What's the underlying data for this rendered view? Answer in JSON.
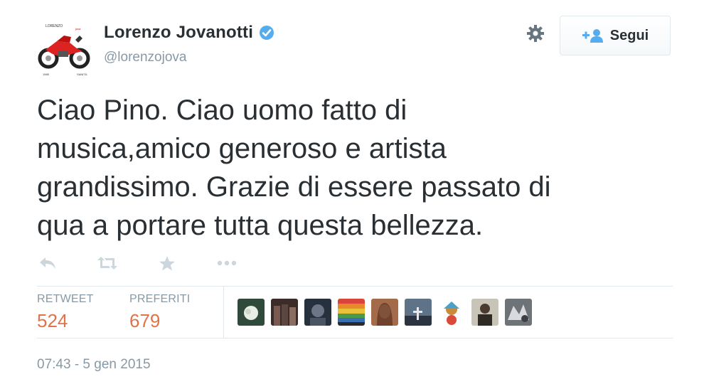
{
  "author": {
    "display_name": "Lorenzo Jovanotti",
    "handle": "@lorenzojova",
    "verified": true,
    "avatar_icon": "motorcycle-logo-icon"
  },
  "follow_button": {
    "label": "Segui",
    "icon": "add-user-icon"
  },
  "settings_icon": "gear-icon",
  "tweet": {
    "text": "Ciao Pino. Ciao uomo fatto di\nmusica,amico generoso e artista\ngrandissimo. Grazie di essere passato di\nqua a portare tutta questa bellezza."
  },
  "actions": [
    {
      "name": "reply-icon"
    },
    {
      "name": "retweet-icon"
    },
    {
      "name": "favorite-icon"
    },
    {
      "name": "more-icon"
    }
  ],
  "stats": {
    "retweet_label": "RETWEET",
    "retweet_count": "524",
    "favorites_label": "PREFERITI",
    "favorites_count": "679"
  },
  "favoriters_avatars_count": 9,
  "timestamp": "07:43 - 5 gen 2015",
  "colors": {
    "text": "#292f33",
    "muted": "#8899a6",
    "count": "#e0734a",
    "verified": "#55acee",
    "border": "#e1e8ed"
  }
}
